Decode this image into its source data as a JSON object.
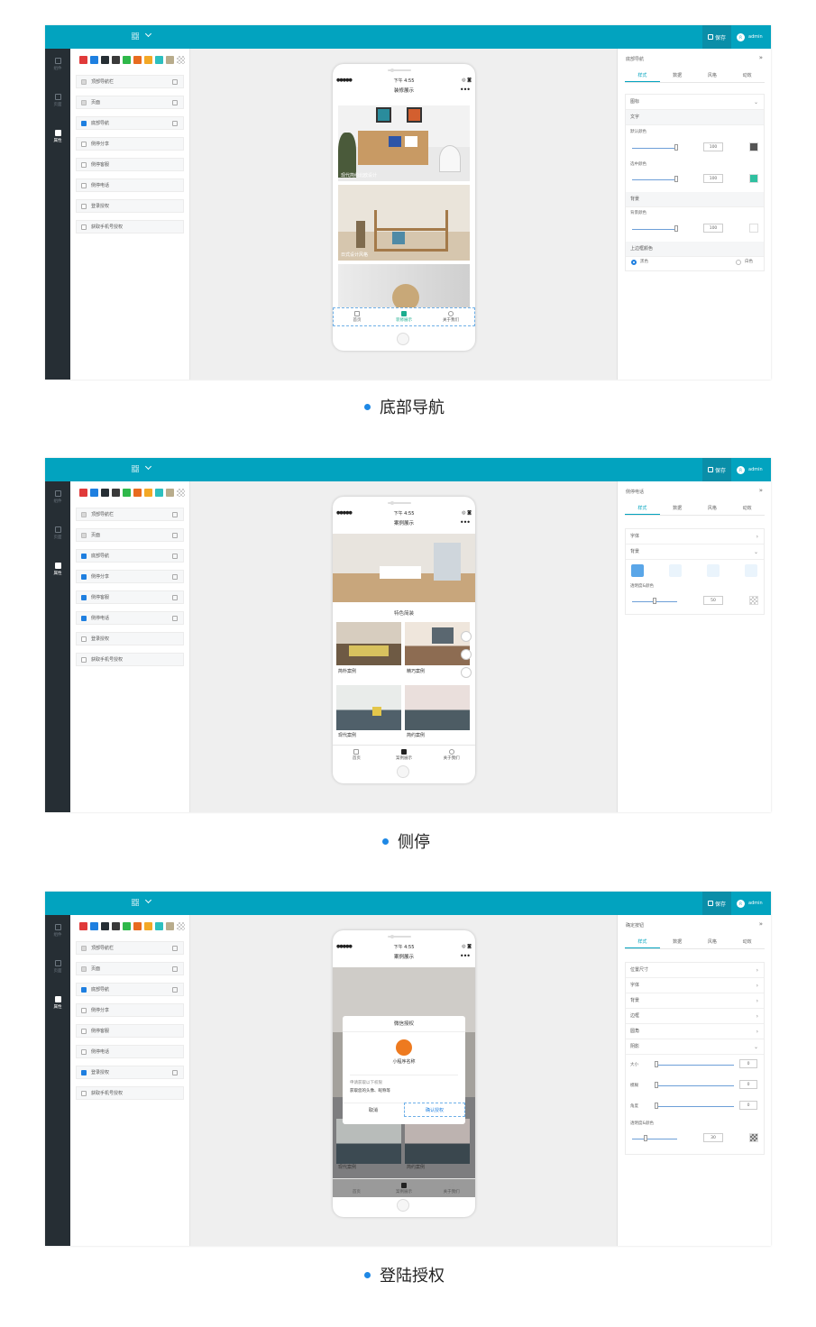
{
  "colors": {
    "teal": "#02a3bf",
    "rail": "#262e34",
    "accent_blue": "#1e7fe0",
    "tab_green": "#1aad8e"
  },
  "top_bar": {
    "save_label": "保存",
    "user_initial": "R",
    "user_name": "admin"
  },
  "rail": {
    "items": [
      "组件",
      "页面",
      "属性"
    ]
  },
  "swatches": [
    "#e03a3a",
    "#1e7fe0",
    "#262e34",
    "#3a3a3a",
    "#2fb84a",
    "#e86b1f",
    "#f3a826",
    "#2cbfbf",
    "#b8ac8c",
    "transparent"
  ],
  "panels": [
    {
      "items": [
        {
          "label": "顶部导航栏",
          "state": "grey",
          "edit": true
        },
        {
          "label": "页面",
          "state": "grey",
          "edit": true
        },
        {
          "label": "底部导航",
          "state": "on",
          "edit": true
        },
        {
          "label": "侧停分享",
          "state": "off",
          "edit": false
        },
        {
          "label": "侧停客服",
          "state": "off",
          "edit": false
        },
        {
          "label": "侧停电话",
          "state": "off",
          "edit": false
        },
        {
          "label": "登录授权",
          "state": "off",
          "edit": false
        },
        {
          "label": "获取手机号授权",
          "state": "off",
          "edit": false
        }
      ],
      "phone": {
        "dots": "●●●●●",
        "time": "下午 4:55",
        "right": "◎ ◙",
        "title": "装修展示",
        "more": "•••",
        "cards": [
          "现代简约北欧设计",
          "日式设计风格"
        ],
        "tabbar": [
          "首页",
          "装修展示",
          "关于我们"
        ]
      },
      "props": {
        "title": "底部导航",
        "tabs": [
          "样式",
          "数据",
          "风格",
          "动效"
        ],
        "lines": [
          "图标",
          "文字",
          "默认颜色",
          "选中颜色",
          "背景",
          "背景颜色",
          "上边框颜色"
        ],
        "values": [
          "100",
          "100",
          "100"
        ],
        "radio": [
          "黑色",
          "白色"
        ]
      },
      "bullet": "底部导航"
    },
    {
      "items": [
        {
          "label": "顶部导航栏",
          "state": "grey",
          "edit": true
        },
        {
          "label": "页面",
          "state": "grey",
          "edit": true
        },
        {
          "label": "底部导航",
          "state": "on",
          "edit": true
        },
        {
          "label": "侧停分享",
          "state": "on",
          "edit": true
        },
        {
          "label": "侧停客服",
          "state": "on",
          "edit": true
        },
        {
          "label": "侧停电话",
          "state": "on",
          "edit": true
        },
        {
          "label": "登录授权",
          "state": "off",
          "edit": false
        },
        {
          "label": "获取手机号授权",
          "state": "off",
          "edit": false
        }
      ],
      "phone": {
        "dots": "●●●●●",
        "time": "下午 4:55",
        "right": "◎ ◙",
        "title": "案例展示",
        "more": "•••",
        "section": "特色简装",
        "grid": [
          "简朴案例",
          "精巧案例",
          "现代案例",
          "简约案例"
        ],
        "tabbar": [
          "首页",
          "案例展示",
          "关于我们"
        ]
      },
      "props": {
        "title": "侧停电话",
        "tabs": [
          "样式",
          "数据",
          "风格",
          "动效"
        ],
        "lines": [
          "字体",
          "背景",
          "透明度&颜色"
        ],
        "values": [
          "50"
        ]
      },
      "bullet": "侧停"
    },
    {
      "items": [
        {
          "label": "顶部导航栏",
          "state": "grey",
          "edit": true
        },
        {
          "label": "页面",
          "state": "grey",
          "edit": true
        },
        {
          "label": "底部导航",
          "state": "on",
          "edit": true
        },
        {
          "label": "侧停分享",
          "state": "off",
          "edit": false
        },
        {
          "label": "侧停客服",
          "state": "off",
          "edit": false
        },
        {
          "label": "侧停电话",
          "state": "off",
          "edit": false
        },
        {
          "label": "登录授权",
          "state": "on",
          "edit": true
        },
        {
          "label": "获取手机号授权",
          "state": "off",
          "edit": false
        }
      ],
      "phone": {
        "dots": "●●●●●",
        "time": "下午 4:55",
        "right": "◎ ◙",
        "title": "案例展示",
        "more": "•••",
        "dialog": {
          "title": "微信授权",
          "app_name": "小程序名称",
          "req": "申请获取以下权限",
          "perm": "获取您的头像、昵称等",
          "cancel": "取消",
          "confirm": "确认授权"
        },
        "grid": [
          "现代案例",
          "简约案例"
        ],
        "tabbar": [
          "首页",
          "案例展示",
          "关于我们"
        ]
      },
      "props": {
        "title": "确定按钮",
        "tabs": [
          "样式",
          "数据",
          "风格",
          "动效"
        ],
        "lines": [
          "位置尺寸",
          "字体",
          "背景",
          "边框",
          "圆角",
          "阴影"
        ],
        "shadow": [
          "大小",
          "模糊",
          "角度"
        ],
        "shadow_values": [
          "0",
          "0",
          "0"
        ],
        "opacity_label": "透明度&颜色",
        "opacity_value": "30"
      },
      "bullet": "登陆授权"
    }
  ]
}
